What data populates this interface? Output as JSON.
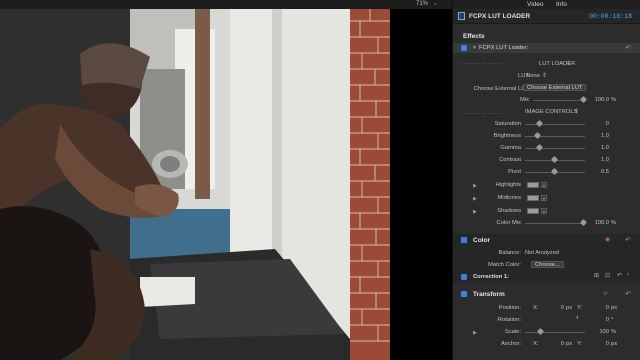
{
  "viewer": {
    "zoom": "71%"
  },
  "tabs": {
    "video": "Video",
    "info": "Info"
  },
  "clip": {
    "name": "FCPX LUT LOADER",
    "timecode": "00:00:18:18"
  },
  "effects": {
    "title": "Effects",
    "plugin_name": "FCPX LUT Loader:",
    "lut_loader_header": "LUT LOADER",
    "lut_label": "LUT",
    "lut_value": "None",
    "choose_label": "Choose External LUT",
    "choose_button": "Choose External LUT",
    "mix_label": "Mix",
    "mix_value": "100.0",
    "mix_unit": "%",
    "image_controls_header": "IMAGE CONTROLS",
    "controls": [
      {
        "label": "Saturation",
        "value": "0"
      },
      {
        "label": "Brightness",
        "value": "1.0"
      },
      {
        "label": "Gamma",
        "value": "1.0"
      },
      {
        "label": "Contrast",
        "value": "1.0"
      },
      {
        "label": "Pivot",
        "value": "0.5"
      }
    ],
    "tone_labels": [
      "Highlights",
      "Midtones",
      "Shadows"
    ],
    "color_mix_label": "Color Mix",
    "color_mix_value": "100.0",
    "color_mix_unit": "%"
  },
  "color": {
    "title": "Color",
    "balance_label": "Balance:",
    "balance_value": "Not Analyzed",
    "match_label": "Match Color:",
    "match_button": "Choose...",
    "correction": "Correction 1:"
  },
  "transform": {
    "title": "Transform",
    "position_label": "Position:",
    "x_label": "X:",
    "y_label": "Y:",
    "pos_x": "0",
    "pos_y": "0",
    "px_unit": "px",
    "rotation_label": "Rotation:",
    "rotation_value": "0",
    "deg_unit": "°",
    "scale_label": "Scale:",
    "scale_value": "100",
    "pct_unit": "%",
    "anchor_label": "Anchor:",
    "anchor_x": "0",
    "anchor_y": "0"
  },
  "icons": [
    "chevron-down-icon",
    "reset-icon",
    "color-wheel-icon",
    "disclosure-triangle-icon",
    "film-icon"
  ]
}
